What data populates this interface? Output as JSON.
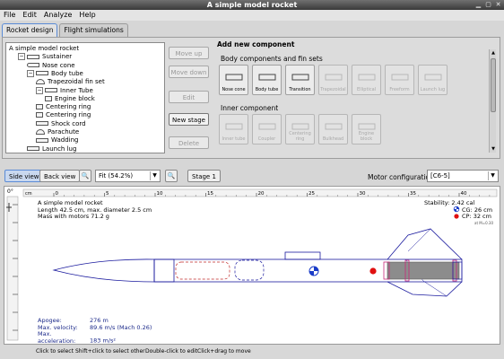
{
  "window": {
    "title": "A simple model rocket"
  },
  "menu": [
    "File",
    "Edit",
    "Analyze",
    "Help"
  ],
  "tabs": [
    "Rocket design",
    "Flight simulations"
  ],
  "tree": [
    {
      "label": "A simple model rocket",
      "indent": 0,
      "icon": "rocket-icon"
    },
    {
      "label": "Sustainer",
      "indent": 1,
      "icon": "stage-icon"
    },
    {
      "label": "Nose cone",
      "indent": 2,
      "icon": "nose-cone-icon"
    },
    {
      "label": "Body tube",
      "indent": 2,
      "icon": "body-tube-icon"
    },
    {
      "label": "Trapezoidal fin set",
      "indent": 3,
      "icon": "fin-set-icon"
    },
    {
      "label": "Inner Tube",
      "indent": 3,
      "icon": "inner-tube-icon"
    },
    {
      "label": "Engine block",
      "indent": 4,
      "icon": "engine-block-icon"
    },
    {
      "label": "Centering ring",
      "indent": 3,
      "icon": "centering-ring-icon"
    },
    {
      "label": "Centering ring",
      "indent": 3,
      "icon": "centering-ring-icon"
    },
    {
      "label": "Shock cord",
      "indent": 3,
      "icon": "shock-cord-icon"
    },
    {
      "label": "Parachute",
      "indent": 3,
      "icon": "parachute-icon"
    },
    {
      "label": "Wadding",
      "indent": 3,
      "icon": "wadding-icon"
    },
    {
      "label": "Launch lug",
      "indent": 2,
      "icon": "launch-lug-icon"
    }
  ],
  "edit_buttons": {
    "move_up": "Move up",
    "move_down": "Move down",
    "edit": "Edit",
    "new_stage": "New stage",
    "delete": "Delete"
  },
  "add_component": {
    "title": "Add new component",
    "body_section": "Body components and fin sets",
    "body_items": [
      {
        "label": "Nose cone",
        "enabled": true,
        "icon": "nose-cone-icon"
      },
      {
        "label": "Body tube",
        "enabled": true,
        "icon": "body-tube-icon"
      },
      {
        "label": "Transition",
        "enabled": true,
        "icon": "transition-icon"
      },
      {
        "label": "Trapezoidal",
        "enabled": false,
        "icon": "trapezoidal-fin-icon"
      },
      {
        "label": "Elliptical",
        "enabled": false,
        "icon": "elliptical-fin-icon"
      },
      {
        "label": "Freeform",
        "enabled": false,
        "icon": "freeform-fin-icon"
      },
      {
        "label": "Launch lug",
        "enabled": false,
        "icon": "launch-lug-icon"
      }
    ],
    "inner_section": "Inner component",
    "inner_items": [
      {
        "label": "Inner tube",
        "enabled": false,
        "icon": "inner-tube-icon"
      },
      {
        "label": "Coupler",
        "enabled": false,
        "icon": "coupler-icon"
      },
      {
        "label": "Centering ring",
        "enabled": false,
        "icon": "centering-ring-icon"
      },
      {
        "label": "Bulkhead",
        "enabled": false,
        "icon": "bulkhead-icon"
      },
      {
        "label": "Engine block",
        "enabled": false,
        "icon": "engine-block-icon"
      }
    ]
  },
  "view_toolbar": {
    "side_view": "Side view",
    "back_view": "Back view",
    "zoom": "Fit (54.2%)",
    "stage": "Stage 1",
    "motor_label": "Motor configuration:",
    "motor_value": "[C6-5]"
  },
  "ruler": {
    "angle": "0°",
    "unit": "cm",
    "ticks": [
      "0",
      "5",
      "10",
      "15",
      "20",
      "25",
      "30",
      "35",
      "40"
    ]
  },
  "design_info": {
    "name": "A simple model rocket",
    "length": "Length 42.5 cm, max. diameter 2.5 cm",
    "mass": "Mass with motors  71.2 g"
  },
  "stability": {
    "stability": "Stability: 2.42 cal",
    "cg": "CG:   26 cm",
    "cp": "CP:   32 cm",
    "mach": "at M=0.30"
  },
  "flight": {
    "apogee_label": "Apogee:",
    "apogee_value": "276 m",
    "velocity_label": "Max. velocity:",
    "velocity_value": "89.6 m/s  (Mach 0.26)",
    "accel_label": "Max. acceleration:",
    "accel_value": "183 m/s²"
  },
  "status": {
    "select": "Click to select",
    "shift": "Shift+click to select other",
    "double": "Double-click to edit",
    "drag": "Click+drag to move"
  },
  "colors": {
    "outline": "#1a1a9e",
    "cg": "#1a3cc8",
    "cp": "#e01010",
    "motor": "#8c8c8c",
    "motor_outline": "#c8287a"
  }
}
